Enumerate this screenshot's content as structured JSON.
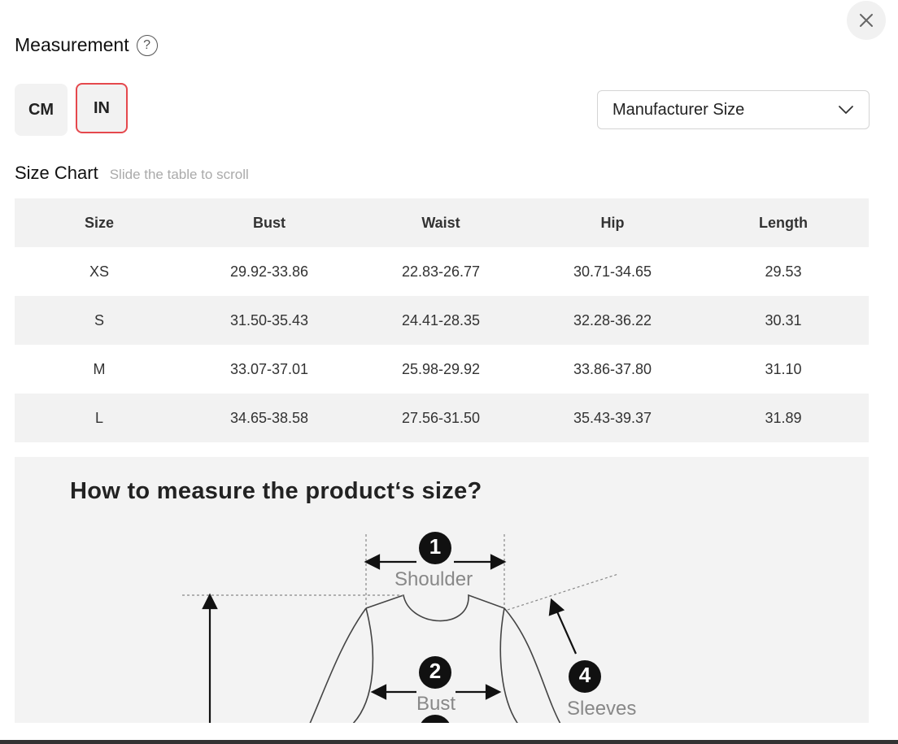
{
  "header": {
    "title": "Measurement",
    "help_glyph": "?"
  },
  "units": {
    "options": [
      "CM",
      "IN"
    ],
    "selected": "IN"
  },
  "size_type": {
    "selected": "Manufacturer Size"
  },
  "size_chart": {
    "title": "Size Chart",
    "hint": "Slide the table to scroll",
    "columns": [
      "Size",
      "Bust",
      "Waist",
      "Hip",
      "Length"
    ],
    "rows": [
      [
        "XS",
        "29.92-33.86",
        "22.83-26.77",
        "30.71-34.65",
        "29.53"
      ],
      [
        "S",
        "31.50-35.43",
        "24.41-28.35",
        "32.28-36.22",
        "30.31"
      ],
      [
        "M",
        "33.07-37.01",
        "25.98-29.92",
        "33.86-37.80",
        "31.10"
      ],
      [
        "L",
        "34.65-38.58",
        "27.56-31.50",
        "35.43-39.37",
        "31.89"
      ]
    ]
  },
  "guide": {
    "title": "How to measure the product‘s size?",
    "labels": [
      {
        "num": "1",
        "text": "Shoulder"
      },
      {
        "num": "2",
        "text": "Bust"
      },
      {
        "num": "4",
        "text": "Sleeves"
      }
    ]
  },
  "icons": {
    "close": "close-icon",
    "help": "help-icon",
    "dropdown": "chevron-down-icon"
  },
  "colors": {
    "accent": "#e5484d",
    "surface": "#f2f2f2"
  }
}
